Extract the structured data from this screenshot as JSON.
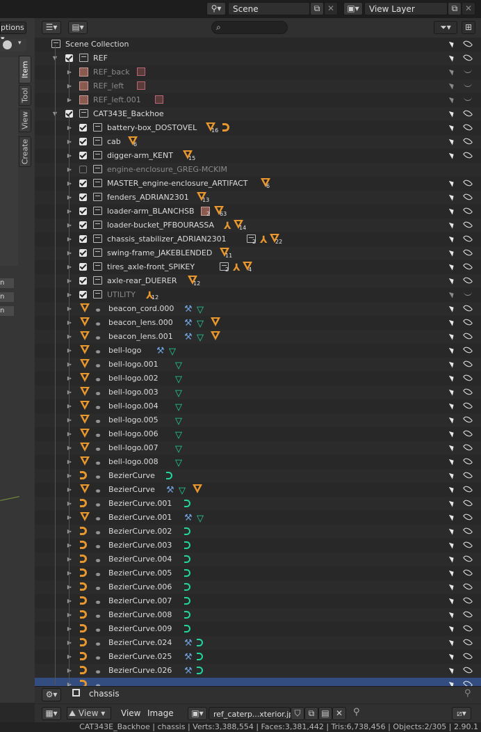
{
  "header": {
    "scene_label": "Scene",
    "view_layer_label": "View Layer"
  },
  "left_panel": {
    "partial_label": "ptions",
    "tabs": [
      "Item",
      "Tool",
      "View",
      "Create"
    ],
    "stubs": [
      "n",
      "n",
      "n"
    ]
  },
  "outliner": {
    "search_placeholder": "",
    "rows": [
      {
        "label": "Scene Collection",
        "type": "scene",
        "indent": 0
      },
      {
        "label": "REF",
        "type": "collection",
        "indent": 1,
        "checkbox": "on",
        "expand": "open"
      },
      {
        "label": "REF_back",
        "type": "image",
        "indent": 2,
        "dim": true,
        "hidden": true
      },
      {
        "label": "REF_left",
        "type": "image",
        "indent": 2,
        "dim": true,
        "hidden": true
      },
      {
        "label": "REF_left.001",
        "type": "image",
        "indent": 2,
        "dim": true,
        "hidden": true
      },
      {
        "label": "CAT343E_Backhoe",
        "type": "collection",
        "indent": 1,
        "checkbox": "on",
        "expand": "open"
      },
      {
        "label": "battery-box_DOSTOVEL",
        "type": "collection",
        "indent": 2,
        "checkbox": "on",
        "badges": [
          {
            "k": "obj",
            "n": "16"
          },
          {
            "k": "curve"
          }
        ]
      },
      {
        "label": "cab",
        "type": "collection",
        "indent": 2,
        "checkbox": "on",
        "badges": [
          {
            "k": "obj",
            "n": "6"
          }
        ]
      },
      {
        "label": "digger-arm_KENT",
        "type": "collection",
        "indent": 2,
        "checkbox": "on",
        "badges": [
          {
            "k": "obj",
            "n": "15"
          }
        ]
      },
      {
        "label": "engine-enclosure_GREG-MCKIM",
        "type": "collection",
        "indent": 2,
        "checkbox": "off",
        "dim": true,
        "noright": true
      },
      {
        "label": "MASTER_engine-enclosure_ARTIFACT",
        "type": "collection",
        "indent": 2,
        "checkbox": "on",
        "badges": [
          {
            "k": "obj",
            "n": "6"
          }
        ]
      },
      {
        "label": "fenders_ADRIAN2301",
        "type": "collection",
        "indent": 2,
        "checkbox": "on",
        "badges": [
          {
            "k": "obj",
            "n": "13"
          }
        ]
      },
      {
        "label": "loader-arm_BLANCHSB",
        "type": "collection",
        "indent": 2,
        "checkbox": "on",
        "badges": [
          {
            "k": "imgb",
            "n": "2"
          },
          {
            "k": "obj",
            "n": "63"
          }
        ]
      },
      {
        "label": "loader-bucket_PFBOURASSA",
        "type": "collection",
        "indent": 2,
        "checkbox": "on",
        "badges": [
          {
            "k": "arm"
          },
          {
            "k": "obj",
            "n": "14"
          }
        ]
      },
      {
        "label": "chassis_stabilizer_ADRIAN2301",
        "type": "collection",
        "indent": 2,
        "checkbox": "on",
        "badges": [
          {
            "k": "coll",
            "n": "2"
          },
          {
            "k": "arm"
          },
          {
            "k": "obj",
            "n": "22"
          }
        ]
      },
      {
        "label": "swing-frame_JAKEBLENDED",
        "type": "collection",
        "indent": 2,
        "checkbox": "on",
        "badges": [
          {
            "k": "obj",
            "n": "11"
          }
        ]
      },
      {
        "label": "tires_axle-front_SPIKEY",
        "type": "collection",
        "indent": 2,
        "checkbox": "on",
        "badges": [
          {
            "k": "coll",
            "n": "2"
          },
          {
            "k": "arm"
          },
          {
            "k": "obj",
            "n": "4"
          }
        ]
      },
      {
        "label": "axle-rear_DUERER",
        "type": "collection",
        "indent": 2,
        "checkbox": "on",
        "badges": [
          {
            "k": "obj",
            "n": "12"
          }
        ]
      },
      {
        "label": "UTILITY",
        "type": "collection",
        "indent": 2,
        "checkbox": "on",
        "dim": true,
        "hidden": true,
        "badges": [
          {
            "k": "arm",
            "n": "12"
          }
        ]
      },
      {
        "label": "beacon_cord.000",
        "type": "obj",
        "indent": 2,
        "badges": [
          {
            "k": "wrench"
          },
          {
            "k": "mesh"
          }
        ]
      },
      {
        "label": "beacon_lens.000",
        "type": "obj",
        "indent": 2,
        "badges": [
          {
            "k": "wrench"
          },
          {
            "k": "mesh"
          },
          {
            "k": "obj"
          }
        ]
      },
      {
        "label": "beacon_lens.001",
        "type": "obj",
        "indent": 2,
        "badges": [
          {
            "k": "wrench"
          },
          {
            "k": "mesh"
          },
          {
            "k": "obj"
          }
        ]
      },
      {
        "label": "bell-logo",
        "type": "obj",
        "indent": 2,
        "badges": [
          {
            "k": "wrench"
          },
          {
            "k": "mesh"
          }
        ]
      },
      {
        "label": "bell-logo.001",
        "type": "obj",
        "indent": 2,
        "badges": [
          {
            "k": "mesh"
          }
        ]
      },
      {
        "label": "bell-logo.002",
        "type": "obj",
        "indent": 2,
        "badges": [
          {
            "k": "mesh"
          }
        ]
      },
      {
        "label": "bell-logo.003",
        "type": "obj",
        "indent": 2,
        "badges": [
          {
            "k": "mesh"
          }
        ]
      },
      {
        "label": "bell-logo.004",
        "type": "obj",
        "indent": 2,
        "badges": [
          {
            "k": "mesh"
          }
        ]
      },
      {
        "label": "bell-logo.005",
        "type": "obj",
        "indent": 2,
        "badges": [
          {
            "k": "mesh"
          }
        ]
      },
      {
        "label": "bell-logo.006",
        "type": "obj",
        "indent": 2,
        "badges": [
          {
            "k": "mesh"
          }
        ]
      },
      {
        "label": "bell-logo.007",
        "type": "obj",
        "indent": 2,
        "badges": [
          {
            "k": "mesh"
          }
        ]
      },
      {
        "label": "bell-logo.008",
        "type": "obj",
        "indent": 2,
        "badges": [
          {
            "k": "mesh"
          }
        ]
      },
      {
        "label": "BezierCurve",
        "type": "curve",
        "indent": 2,
        "badges": [
          {
            "k": "crv"
          }
        ]
      },
      {
        "label": "BezierCurve",
        "type": "obj",
        "indent": 2,
        "badges": [
          {
            "k": "wrench"
          },
          {
            "k": "mesh"
          },
          {
            "k": "obj"
          }
        ]
      },
      {
        "label": "BezierCurve.001",
        "type": "curve",
        "indent": 2,
        "badges": [
          {
            "k": "crv"
          }
        ]
      },
      {
        "label": "BezierCurve.001",
        "type": "obj",
        "indent": 2,
        "badges": [
          {
            "k": "wrench"
          },
          {
            "k": "mesh"
          }
        ]
      },
      {
        "label": "BezierCurve.002",
        "type": "curve",
        "indent": 2,
        "badges": [
          {
            "k": "crv"
          }
        ]
      },
      {
        "label": "BezierCurve.003",
        "type": "curve",
        "indent": 2,
        "badges": [
          {
            "k": "crv"
          }
        ]
      },
      {
        "label": "BezierCurve.004",
        "type": "curve",
        "indent": 2,
        "badges": [
          {
            "k": "crv"
          }
        ]
      },
      {
        "label": "BezierCurve.005",
        "type": "curve",
        "indent": 2,
        "badges": [
          {
            "k": "crv"
          }
        ]
      },
      {
        "label": "BezierCurve.006",
        "type": "curve",
        "indent": 2,
        "badges": [
          {
            "k": "crv"
          }
        ]
      },
      {
        "label": "BezierCurve.007",
        "type": "curve",
        "indent": 2,
        "badges": [
          {
            "k": "crv"
          }
        ]
      },
      {
        "label": "BezierCurve.008",
        "type": "curve",
        "indent": 2,
        "badges": [
          {
            "k": "crv"
          }
        ]
      },
      {
        "label": "BezierCurve.009",
        "type": "curve",
        "indent": 2,
        "badges": [
          {
            "k": "crv"
          }
        ]
      },
      {
        "label": "BezierCurve.024",
        "type": "curve",
        "indent": 2,
        "badges": [
          {
            "k": "wrench"
          },
          {
            "k": "crv"
          }
        ]
      },
      {
        "label": "BezierCurve.025",
        "type": "curve",
        "indent": 2,
        "badges": [
          {
            "k": "wrench"
          },
          {
            "k": "crv"
          }
        ]
      },
      {
        "label": "BezierCurve.026",
        "type": "curve",
        "indent": 2,
        "badges": [
          {
            "k": "wrench"
          },
          {
            "k": "crv"
          }
        ]
      },
      {
        "label": "",
        "type": "curve",
        "indent": 2,
        "selected": true,
        "badges": []
      }
    ]
  },
  "properties_bar": {
    "active_object": "chassis"
  },
  "image_editor_header": {
    "menus": [
      "View",
      "View",
      "Image"
    ],
    "image_name": "ref_caterp...xterior.jpg"
  },
  "status_bar": {
    "text": "CAT343E_Backhoe | chassis | Verts:3,388,554 | Faces:3,381,442 | Tris:6,738,456 | Objects:2/305 | 2.90.1"
  },
  "colors": {
    "object_orange": "#e8962e",
    "mesh_green": "#22d6a0",
    "modifier_blue": "#6f9ed8",
    "selection_blue": "#334d80"
  }
}
